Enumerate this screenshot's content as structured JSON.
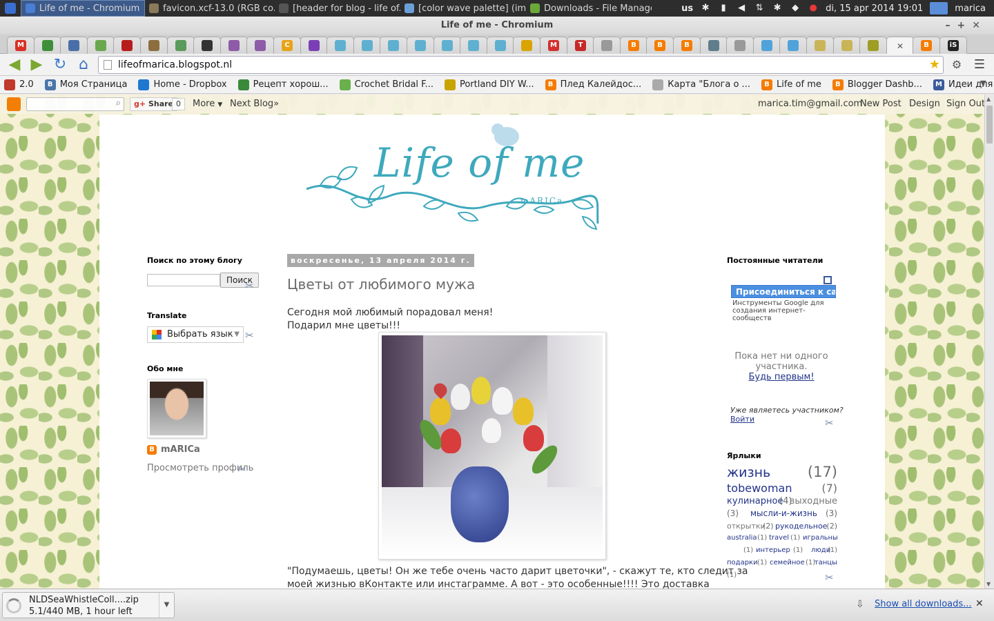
{
  "system_panel": {
    "tasks": [
      {
        "label": "Life of me - Chromium",
        "active": true,
        "icon_color": "#4a7fd4",
        "icon": "chromium-icon"
      },
      {
        "label": "favicon.xcf-13.0 (RGB co...",
        "active": false,
        "icon_color": "#8a7a5a",
        "icon": "gimp-icon"
      },
      {
        "label": "[header for blog - life of...",
        "active": false,
        "icon_color": "#555",
        "icon": "gimp-window-icon"
      },
      {
        "label": "[color wave palette] (im...",
        "active": false,
        "icon_color": "#6aa0d8",
        "icon": "image-icon"
      },
      {
        "label": "Downloads - File Manager",
        "active": false,
        "icon_color": "#6aa83a",
        "icon": "download-folder-icon"
      }
    ],
    "keyboard_layout": "us",
    "clock": "di, 15 apr 2014 19:01",
    "user": "marica"
  },
  "window": {
    "title": "Life of me - Chromium"
  },
  "tabs": [
    {
      "icon": "gmail-icon",
      "color": "#d93025",
      "glyph": "M"
    },
    {
      "icon": "green-app-icon",
      "color": "#3f8f3a",
      "glyph": ""
    },
    {
      "icon": "doc-icon",
      "color": "#4a6fa8",
      "glyph": ""
    },
    {
      "icon": "leaf-icon",
      "color": "#6aa84f",
      "glyph": ""
    },
    {
      "icon": "red-book-icon",
      "color": "#b71c1c",
      "glyph": ""
    },
    {
      "icon": "basket-icon",
      "color": "#8d6e3f",
      "glyph": ""
    },
    {
      "icon": "landscape-icon",
      "color": "#5a9a5a",
      "glyph": ""
    },
    {
      "icon": "cat-icon",
      "color": "#333333",
      "glyph": ""
    },
    {
      "icon": "purple-app-icon",
      "color": "#8e5ba8",
      "glyph": ""
    },
    {
      "icon": "purple-app-icon",
      "color": "#8e5ba8",
      "glyph": ""
    },
    {
      "icon": "c-logo-icon",
      "color": "#e8a317",
      "glyph": "C"
    },
    {
      "icon": "flower-icon",
      "color": "#7b3fb5",
      "glyph": ""
    },
    {
      "icon": "umbrella-icon",
      "color": "#5fb0d0",
      "glyph": ""
    },
    {
      "icon": "umbrella-icon",
      "color": "#5fb0d0",
      "glyph": ""
    },
    {
      "icon": "umbrella-icon",
      "color": "#5fb0d0",
      "glyph": ""
    },
    {
      "icon": "umbrella-icon",
      "color": "#5fb0d0",
      "glyph": ""
    },
    {
      "icon": "umbrella-icon",
      "color": "#5fb0d0",
      "glyph": ""
    },
    {
      "icon": "umbrella-icon",
      "color": "#5fb0d0",
      "glyph": ""
    },
    {
      "icon": "umbrella-icon",
      "color": "#5fb0d0",
      "glyph": ""
    },
    {
      "icon": "chart-icon",
      "color": "#d9a400",
      "glyph": ""
    },
    {
      "icon": "m-logo-icon",
      "color": "#d32f2f",
      "glyph": "M"
    },
    {
      "icon": "t-logo-icon",
      "color": "#c62828",
      "glyph": "T"
    },
    {
      "icon": "page-icon",
      "color": "#999999",
      "glyph": ""
    },
    {
      "icon": "blogger-icon",
      "color": "#f57c00",
      "glyph": "B"
    },
    {
      "icon": "blogger-icon",
      "color": "#f57c00",
      "glyph": "B"
    },
    {
      "icon": "blogger-icon",
      "color": "#f57c00",
      "glyph": "B"
    },
    {
      "icon": "snowflake-icon",
      "color": "#607d8b",
      "glyph": ""
    },
    {
      "icon": "page-icon",
      "color": "#999999",
      "glyph": ""
    },
    {
      "icon": "blue-flower-icon",
      "color": "#4fa3d9",
      "glyph": ""
    },
    {
      "icon": "blue-flower-icon",
      "color": "#4fa3d9",
      "glyph": ""
    },
    {
      "icon": "daisy-icon",
      "color": "#c9b458",
      "glyph": ""
    },
    {
      "icon": "daisy-icon",
      "color": "#c9b458",
      "glyph": ""
    },
    {
      "icon": "pencil-icon",
      "color": "#9e9d24",
      "glyph": ""
    },
    {
      "icon": "close-icon",
      "color": "#f4f4f4",
      "glyph": "✕",
      "active": true
    },
    {
      "icon": "blogger-icon",
      "color": "#f57c00",
      "glyph": "B"
    },
    {
      "icon": "is-logo-icon",
      "color": "#222222",
      "glyph": "iS"
    }
  ],
  "toolbar": {
    "url": "lifeofmarica.blogspot.nl"
  },
  "bookmarks": [
    {
      "label": "2.0",
      "icon": "bookmark-red-icon",
      "color": "#c0392b"
    },
    {
      "label": "Моя Страница",
      "icon": "vk-icon",
      "color": "#4a76a8",
      "glyph": "B"
    },
    {
      "label": "Home - Dropbox",
      "icon": "dropbox-icon",
      "color": "#1e78d0"
    },
    {
      "label": "Рецепт хорош...",
      "icon": "green-circle-icon",
      "color": "#3a8a3a"
    },
    {
      "label": "Crochet Bridal F...",
      "icon": "green-blob-icon",
      "color": "#6ab04c"
    },
    {
      "label": "Portland DIY W...",
      "icon": "chart-icon",
      "color": "#c9a400"
    },
    {
      "label": "Плед Калейдос...",
      "icon": "blogger-icon",
      "color": "#f57c00",
      "glyph": "B"
    },
    {
      "label": "Карта \"Блога о ...",
      "icon": "page-icon",
      "color": "#aaaaaa"
    },
    {
      "label": "Life of me",
      "icon": "blogger-icon",
      "color": "#f57c00",
      "glyph": "B"
    },
    {
      "label": "Blogger Dashb...",
      "icon": "blogger-icon",
      "color": "#f57c00",
      "glyph": "B"
    },
    {
      "label": "Идеи для книж...",
      "icon": "m-script-icon",
      "color": "#3b5b9b",
      "glyph": "M"
    }
  ],
  "blogger_navbar": {
    "share_label": "Share",
    "share_count": "0",
    "more_label": "More",
    "next_blog_label": "Next Blog»",
    "email": "marica.tim@gmail.com",
    "new_post_label": "New Post",
    "design_label": "Design",
    "sign_out_label": "Sign Out"
  },
  "header": {
    "title": "Life of me",
    "subtitle": "mARICa"
  },
  "left_sidebar": {
    "search_title": "Поиск по этому блогу",
    "search_button": "Поиск",
    "translate_title": "Translate",
    "translate_select": "Выбрать язык",
    "about_title": "Обо мне",
    "profile_name": "mARICa",
    "view_profile": "Просмотреть профиль"
  },
  "post": {
    "date": "воскресенье, 13 апреля 2014 г.",
    "title": "Цветы от любимого мужа",
    "line1": "Сегодня мой любимый порадовал меня!",
    "line2": "Подарил мне цветы!!!",
    "para1": "\"Подумаешь, цветы! Он же тебе очень часто дарит цветочки\", - скажут те, кто следит за",
    "para2": "моей жизнью вКонтакте или инстаграмме. А вот - это особенные!!!! Это доставка"
  },
  "right_sidebar": {
    "followers_title": "Постоянные читатели",
    "join_button": "Присоединиться к сай",
    "google_tools": "Инструменты Google для создания интернет-сообществ",
    "no_members": "Пока нет ни одного участника.",
    "be_first": "Будь первым!",
    "already_member": "Уже являетесь участником?",
    "login": "Войти",
    "labels_title": "Ярлыки",
    "labels": [
      {
        "name": "жизнь",
        "count": "(17)"
      },
      {
        "name": "tobewoman",
        "count": "(7)"
      },
      {
        "name": "кулинарное",
        "count": "(4)"
      },
      {
        "name": "выходные",
        "count": "(3)"
      },
      {
        "name": "мысли-и-жизнь",
        "count": "(3)"
      },
      {
        "name": "открытки",
        "count": "(2)"
      },
      {
        "name": "рукодельное",
        "count": "(2)"
      },
      {
        "name": "australia",
        "count": "(1)"
      },
      {
        "name": "travel",
        "count": "(1)"
      },
      {
        "name": "игральный дом",
        "count": "(1)"
      },
      {
        "name": "интерьер",
        "count": "(1)"
      },
      {
        "name": "люди",
        "count": "(1)"
      },
      {
        "name": "подарки",
        "count": "(1)"
      },
      {
        "name": "семейное",
        "count": "(1)"
      },
      {
        "name": "танцы",
        "count": "(1)"
      }
    ]
  },
  "download_shelf": {
    "file_name": "NLDSeaWhistleColl....zip",
    "progress_text": "5.1/440 MB, 1 hour left",
    "show_all": "Show all downloads..."
  },
  "colors": {
    "accent": "#3ea9bd",
    "link": "#223388",
    "blogger_orange": "#f57c00"
  }
}
